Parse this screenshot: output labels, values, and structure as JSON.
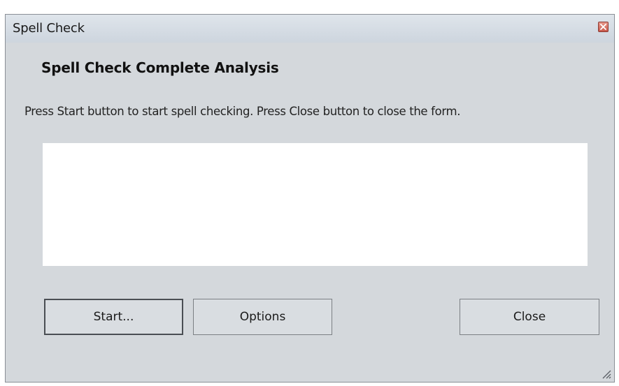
{
  "window": {
    "title": "Spell Check",
    "close_icon": "close-icon"
  },
  "main": {
    "heading": "Spell Check Complete Analysis",
    "instruction": "Press Start button to start spell checking. Press Close button to close the form.",
    "results_text": ""
  },
  "buttons": {
    "start_label": "Start...",
    "options_label": "Options",
    "close_label": "Close"
  },
  "colors": {
    "dialog_background": "#d4d8dc",
    "titlebar_background": "#d6dde5",
    "close_button": "#c8584a",
    "results_background": "#ffffff"
  },
  "icons": [
    "close-icon",
    "resize-grip-icon"
  ]
}
